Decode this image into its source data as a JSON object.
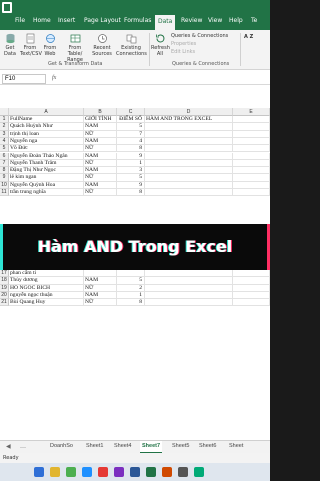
{
  "tabs": [
    "File",
    "Home",
    "Insert",
    "Page Layout",
    "Formulas",
    "Data",
    "Review",
    "View",
    "Help",
    "Te"
  ],
  "active_tab": "Data",
  "ribbon": {
    "get_data": "Get Data",
    "from_text": "From Text/CSV",
    "from_web": "From Web",
    "from_table": "From Table/ Range",
    "recent_sources": "Recent Sources",
    "existing_connections": "Existing Connections",
    "refresh_all": "Refresh All",
    "queries_connections": "Queries & Connections",
    "properties": "Properties",
    "edit_links": "Edit Links",
    "group_get_transform": "Get & Transform Data",
    "group_queries": "Queries & Connections",
    "sort_label": "A Z"
  },
  "formula_bar": {
    "name_box": "F10",
    "fx": "fx",
    "value": ""
  },
  "columns": [
    "A",
    "B",
    "C",
    "D",
    "E"
  ],
  "rows": [
    {
      "n": "1",
      "a": "FullName",
      "b": "GIỚI TÍNH",
      "c": "ĐIỂM SỐ",
      "d": "HÀM AND TRONG EXCEL"
    },
    {
      "n": "2",
      "a": "Quách Huỳnh Như",
      "b": "NAM",
      "c": "5",
      "d": ""
    },
    {
      "n": "3",
      "a": "trịnh thị loan",
      "b": "NỮ",
      "c": "7",
      "d": ""
    },
    {
      "n": "4",
      "a": "Nguyễn nga",
      "b": "NAM",
      "c": "4",
      "d": ""
    },
    {
      "n": "5",
      "a": "Võ Đức",
      "b": "NỮ",
      "c": "8",
      "d": ""
    },
    {
      "n": "6",
      "a": "Nguyễn Đoàn Thảo Ngân",
      "b": "NAM",
      "c": "9",
      "d": ""
    },
    {
      "n": "7",
      "a": "Nguyễn Thanh Trâm",
      "b": "NỮ",
      "c": "1",
      "d": ""
    },
    {
      "n": "8",
      "a": "Đặng Thị Như Ngọc",
      "b": "NAM",
      "c": "3",
      "d": ""
    },
    {
      "n": "9",
      "a": "lê kim ngan",
      "b": "NỮ",
      "c": "5",
      "d": ""
    },
    {
      "n": "10",
      "a": "Nguyễn Quỳnh Hoa",
      "b": "NAM",
      "c": "9",
      "d": ""
    },
    {
      "n": "11",
      "a": "trần trung nghĩa",
      "b": "NỮ",
      "c": "8",
      "d": ""
    },
    {
      "n": "17",
      "a": "phan cẩm ti",
      "b": "",
      "c": "",
      "d": ""
    },
    {
      "n": "18",
      "a": "Thùy dương",
      "b": "NAM",
      "c": "5",
      "d": ""
    },
    {
      "n": "19",
      "a": "HO NGOC BICH",
      "b": "NỮ",
      "c": "2",
      "d": ""
    },
    {
      "n": "20",
      "a": "nguyễn ngọc thuận",
      "b": "NAM",
      "c": "1",
      "d": ""
    },
    {
      "n": "21",
      "a": "Bùi Quang Huy",
      "b": "NỮ",
      "c": "8",
      "d": ""
    }
  ],
  "banner_title": "Hàm AND Trong Excel",
  "sheets": [
    "DoanhSo",
    "Sheet1",
    "Sheet4",
    "Sheet7",
    "Sheet5",
    "Sheet6",
    "Sheet"
  ],
  "active_sheet": "Sheet7",
  "status": "Ready",
  "colors": {
    "excel_green": "#217346",
    "banner_bg": "#0a0a0a",
    "accent_cyan": "#2ee6d6",
    "accent_pink": "#ff2e63"
  }
}
